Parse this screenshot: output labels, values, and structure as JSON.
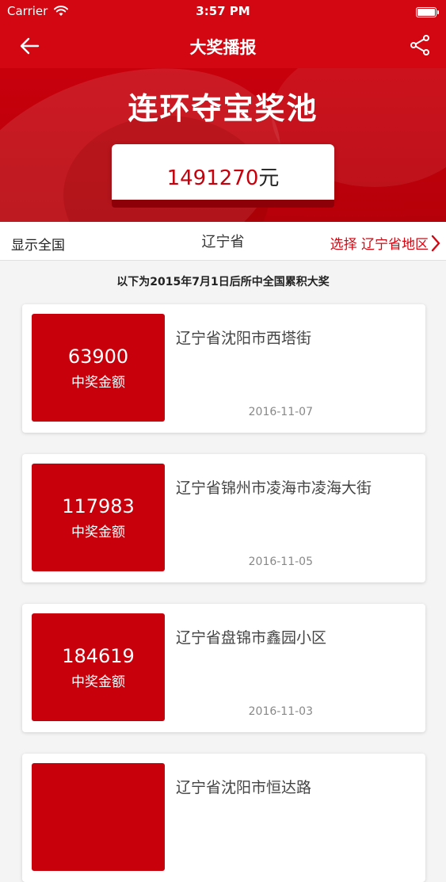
{
  "status": {
    "carrier": "Carrier",
    "time": "3:57 PM"
  },
  "nav": {
    "title": "大奖播报"
  },
  "banner": {
    "pool_title": "连环夺宝奖池",
    "amount": "1491270",
    "unit": "元"
  },
  "filter": {
    "show_all": "显示全国",
    "province": "辽宁省",
    "select": "选择 辽宁省地区"
  },
  "notice": "以下为2015年7月1日后所中全国累积大奖",
  "prize_label": "中奖金额",
  "cards": [
    {
      "amount": "63900",
      "label": "中奖金额",
      "address": "辽宁省沈阳市西塔街",
      "date": "2016-11-07"
    },
    {
      "amount": "117983",
      "label": "中奖金额",
      "address": "辽宁省锦州市凌海市凌海大街",
      "date": "2016-11-05"
    },
    {
      "amount": "184619",
      "label": "中奖金额",
      "address": "辽宁省盘锦市鑫园小区",
      "date": "2016-11-03"
    },
    {
      "amount": "",
      "label": "",
      "address": "辽宁省沈阳市恒达路",
      "date": ""
    }
  ],
  "colors": {
    "brand_red": "#d20712",
    "prize_red": "#c8000c"
  },
  "icons": {
    "back": "arrow-left-icon",
    "share": "share-icon",
    "wifi": "wifi-icon",
    "battery": "battery-icon",
    "chevron": "chevron-right-icon"
  }
}
